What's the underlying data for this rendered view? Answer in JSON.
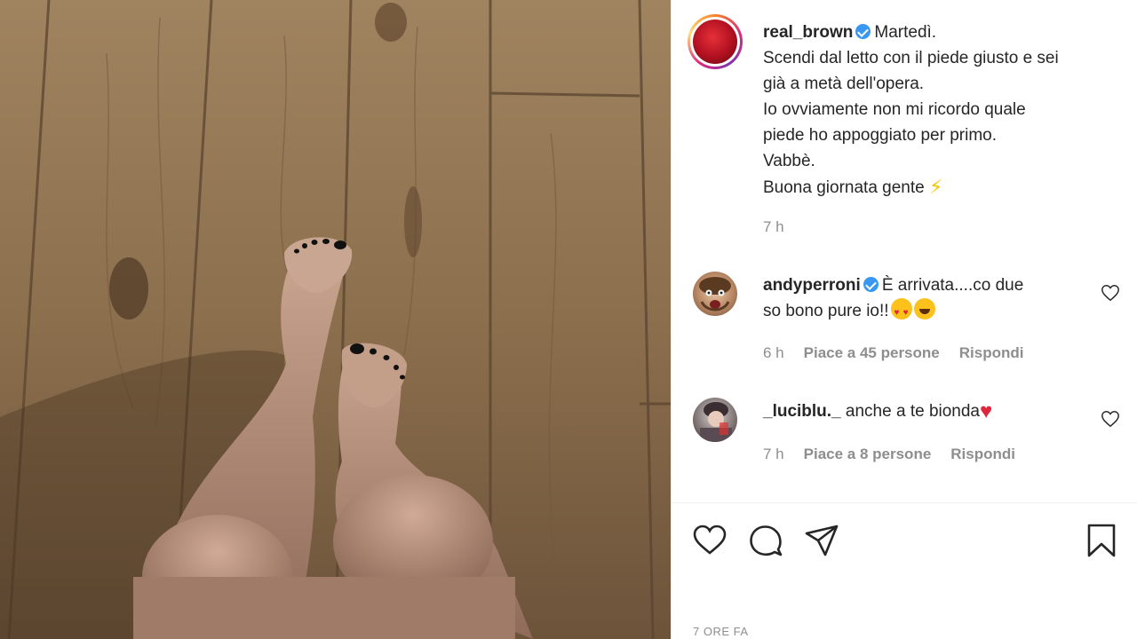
{
  "post": {
    "username": "real_brown",
    "caption_lines": [
      "Martedì.",
      "Scendi dal letto con il piede giusto e sei",
      "già a metà dell'opera.",
      "Io ovviamente non mi ricordo quale",
      "piede ho appoggiato per primo.",
      "Vabbè.",
      "Buona giornata gente"
    ],
    "time": "7 h"
  },
  "comments": [
    {
      "username": "andyperroni",
      "text_line1": "È arrivata....co due",
      "text_line2": "so bono pure io!!",
      "time": "6 h",
      "likes": "Piace a 45 persone",
      "reply": "Rispondi"
    },
    {
      "username": "_luciblu._",
      "text": "anche a te bionda",
      "time": "7 h",
      "likes": "Piace a 8 persone",
      "reply": "Rispondi"
    }
  ],
  "footer": {
    "timestamp": "7 ORE FA"
  },
  "icons": {
    "like": "heart-outline-icon",
    "comment": "comment-bubble-icon",
    "share": "paper-plane-icon",
    "save": "bookmark-icon"
  },
  "colors": {
    "verified": "#3897f0",
    "muted_text": "#8e8e8e"
  }
}
